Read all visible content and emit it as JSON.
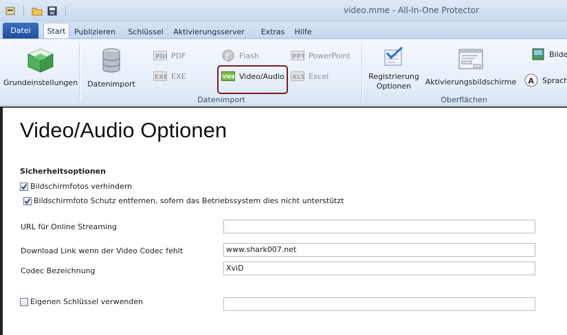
{
  "window": {
    "title": "video.mme - All-In-One Protector"
  },
  "tabs": {
    "file": "Datei",
    "items": [
      "Start",
      "Publizieren",
      "Schlüssel",
      "Aktivierungsserver",
      "Extras",
      "Hilfe"
    ]
  },
  "ribbon": {
    "grundeinstellungen": "Grundeinstellungen",
    "datenimport_button": "Datenimport",
    "pdf": "PDF",
    "exe": "EXE",
    "flash": "Flash",
    "video_audio": "Video/Audio",
    "powerpoint": "PowerPoint",
    "excel": "Excel",
    "group_datenimport": "Datenimport",
    "registrierung_optionen_1": "Registrierung",
    "registrierung_optionen_2": "Optionen",
    "aktivierungsbildschirme": "Aktivierungsbildschirme",
    "group_oberflaechen": "Oberflächen",
    "bilder": "Bilder",
    "sprache": "Sprache"
  },
  "content": {
    "page_title": "Video/Audio Optionen",
    "section_title": "Sicherheitsoptionen",
    "chk_screenshots": "Bildschirmfotos verhindern",
    "chk_remove_protection": "Bildschirmfoto Schutz entfernen, sofern das Betriebssystem dies nicht unterstützt",
    "url_label": "URL für Online Streaming",
    "url_value": "",
    "download_label": "Download Link wenn der Video Codec fehlt",
    "download_value": "www.shark007.net",
    "codec_label": "Codec Bezeichnung",
    "codec_value": "XviD",
    "own_key_label": "Eigenen Schlüssel verwenden",
    "own_key_value": ""
  },
  "state": {
    "chk_screenshots": true,
    "chk_remove_protection": true,
    "chk_own_key": false
  }
}
